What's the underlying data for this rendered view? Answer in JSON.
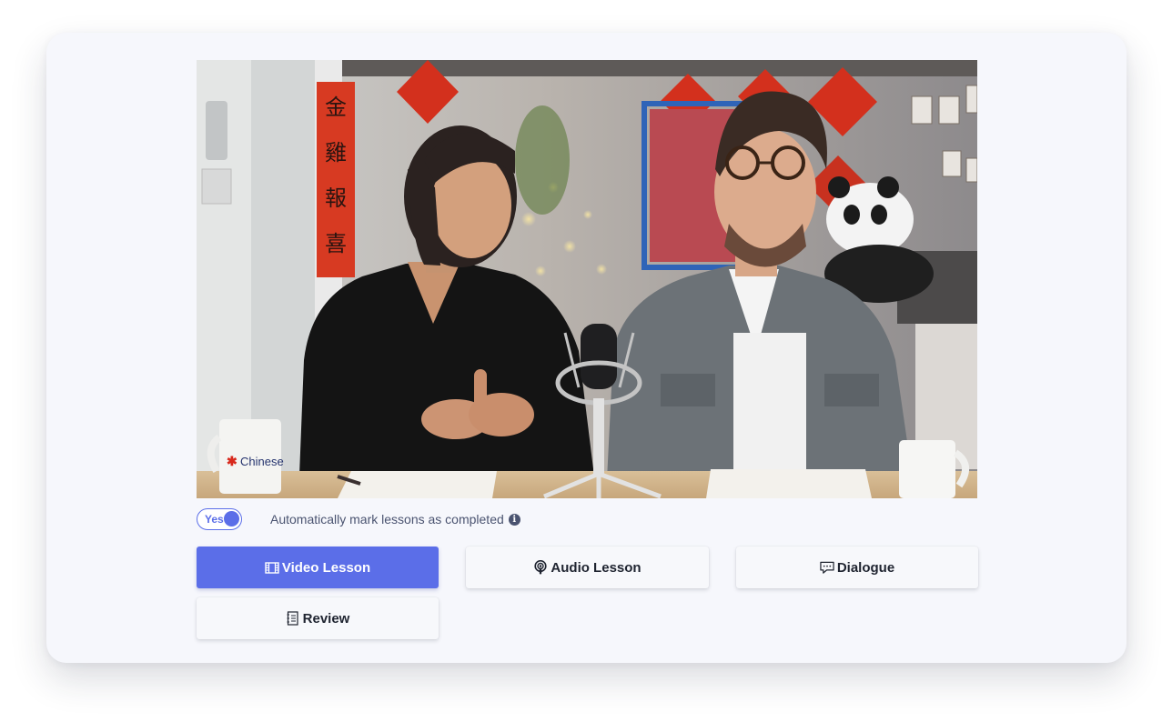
{
  "video": {
    "mug_text": "Chinese"
  },
  "autocomplete": {
    "toggle_label": "Yes",
    "enabled": true,
    "description": "Automatically mark lessons as completed",
    "info_icon": "info-icon"
  },
  "tabs": [
    {
      "label": "Video Lesson",
      "icon": "film-icon",
      "active": true
    },
    {
      "label": "Audio Lesson",
      "icon": "podcast-icon",
      "active": false
    },
    {
      "label": "Dialogue",
      "icon": "chat-icon",
      "active": false
    },
    {
      "label": "Review",
      "icon": "notebook-icon",
      "active": false
    }
  ],
  "colors": {
    "accent": "#5b6ee8",
    "card_background": "#f6f7fc",
    "text": "#1f2430"
  }
}
